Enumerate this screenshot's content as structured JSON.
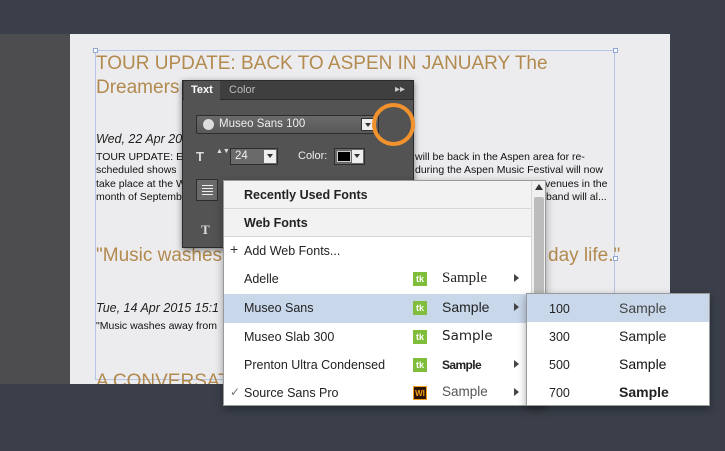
{
  "document": {
    "headline1_line1": "TOUR UPDATE: BACK TO ASPEN IN JANUARY The",
    "headline1_line2": "Dreamers",
    "date1": "Wed, 22 Apr 20",
    "body1_line1_left": "TOUR UPDATE: E",
    "body1_line1_right": "will be back in the Aspen area for re-",
    "body1_line2_left": "scheduled shows",
    "body1_line2_right": "during the Aspen Music Festival will now",
    "body1_line3_left": "take place at the W",
    "body1_line3_right": "venues in the",
    "body1_line4_left": "month of Septemb",
    "body1_line4_right": "band will al...",
    "headline2_left": "\"Music washes",
    "headline2_right": "day life.\"",
    "date2": "Tue, 14 Apr 2015 15:1",
    "body2_line1": "\"Music washes away from",
    "headline3": "A CONVERSAT"
  },
  "panel": {
    "tab_text": "Text",
    "tab_color": "Color",
    "menu_glyph": "▸▸",
    "font_value": "Museo Sans 100",
    "size_value": "24",
    "color_label": "Color:",
    "size_icon_glyph": "T",
    "type_icon_glyph": "T",
    "stepper_glyph": "▲▼"
  },
  "font_menu": {
    "recent_heading": "Recently Used Fonts",
    "web_heading": "Web Fonts",
    "add_web_fonts": "Add Web Fonts...",
    "plus_glyph": "+",
    "check_glyph": "✓",
    "tk_glyph": "tk",
    "ai_glyph": "WI",
    "items": [
      {
        "name": "Adelle",
        "sample": "Sample"
      },
      {
        "name": "Museo Sans",
        "sample": "Sample"
      },
      {
        "name": "Museo Slab 300",
        "sample": "Sample"
      },
      {
        "name": "Prenton Ultra Condensed",
        "sample": "Sample"
      },
      {
        "name": "Source Sans Pro",
        "sample": "Sample"
      }
    ]
  },
  "submenu": {
    "items": [
      {
        "weight": "100",
        "sample": "Sample"
      },
      {
        "weight": "300",
        "sample": "Sample"
      },
      {
        "weight": "500",
        "sample": "Sample"
      },
      {
        "weight": "700",
        "sample": "Sample"
      }
    ]
  },
  "colors": {
    "background": "#3a3f4a",
    "headline": "#b28a4e",
    "highlight_ring": "#f2922c",
    "selection": "#c9d7ea",
    "typekit_green": "#7fbd3a"
  }
}
